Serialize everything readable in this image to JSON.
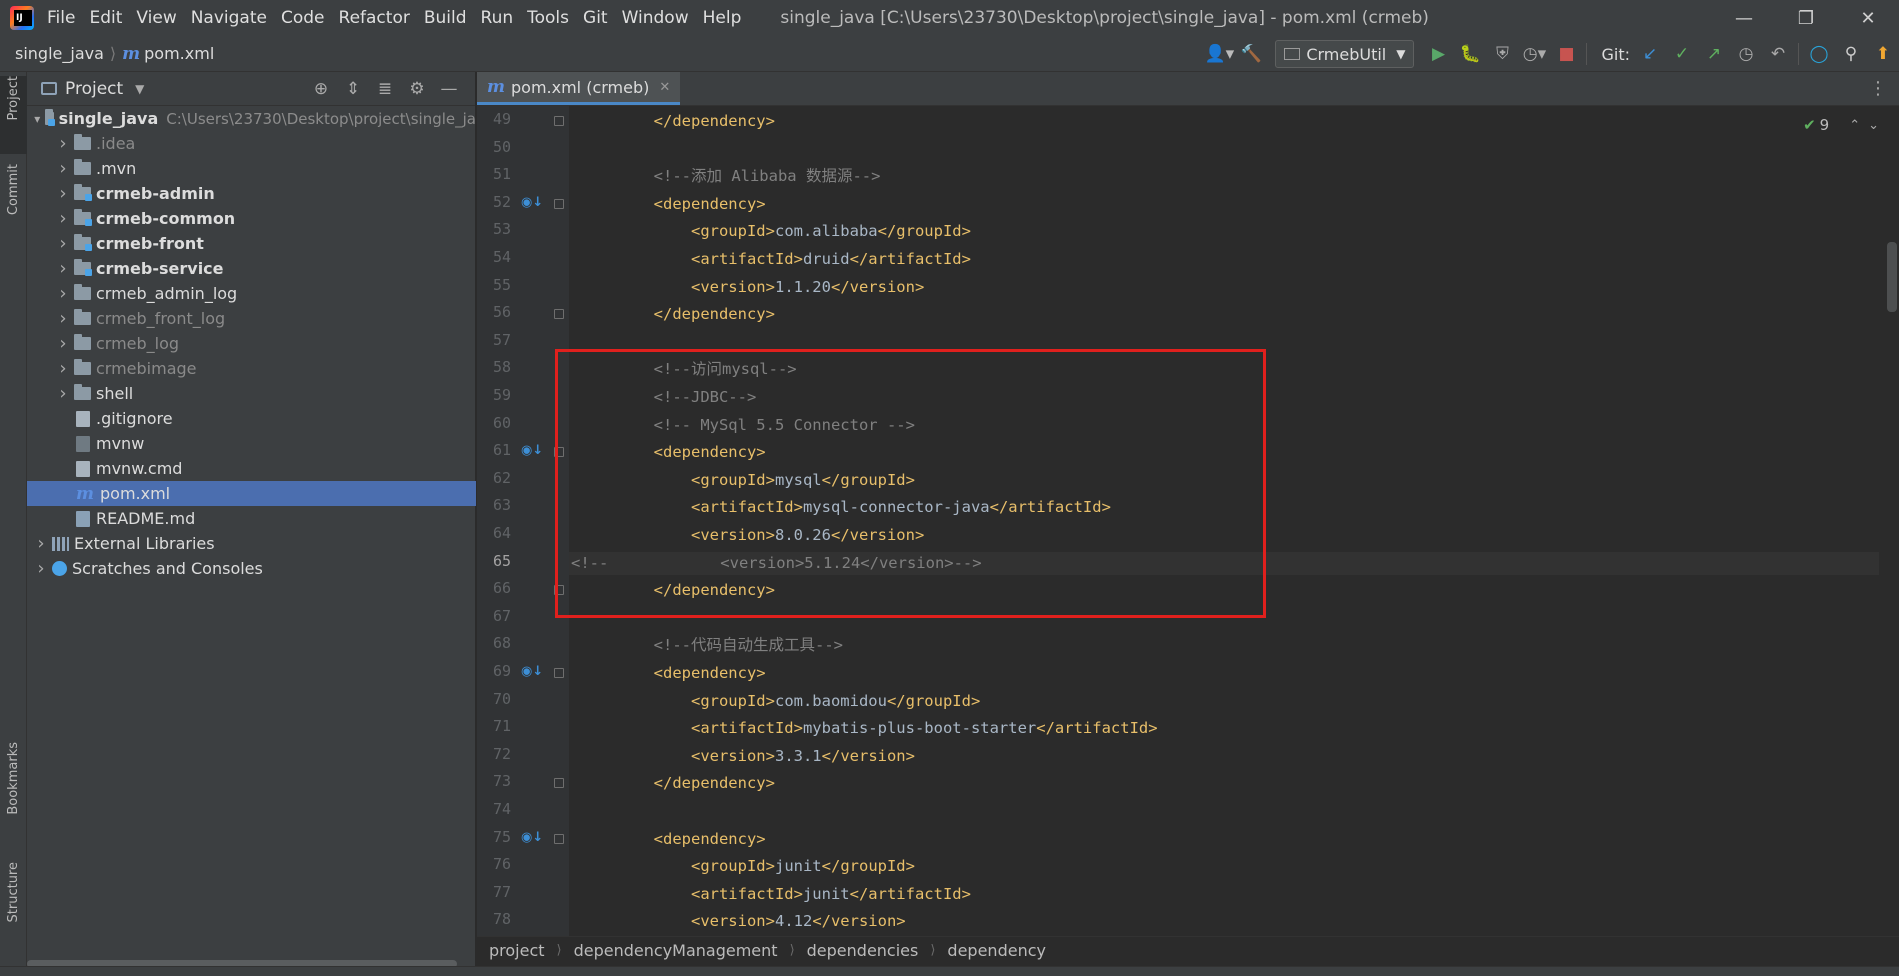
{
  "menubar": {
    "items": [
      "File",
      "Edit",
      "View",
      "Navigate",
      "Code",
      "Refactor",
      "Build",
      "Run",
      "Tools",
      "Git",
      "Window",
      "Help"
    ],
    "window_title": "single_java [C:\\Users\\23730\\Desktop\\project\\single_java] - pom.xml (crmeb)"
  },
  "navbar": {
    "project": "single_java",
    "file": "pom.xml",
    "run_config": "CrmebUtil",
    "git_label": "Git:"
  },
  "left_strip": {
    "tabs": [
      "Project",
      "Commit",
      "Bookmarks",
      "Structure"
    ]
  },
  "project_panel": {
    "title": "Project",
    "tree": [
      {
        "label": "single_java",
        "hint": "C:\\Users\\23730\\Desktop\\project\\single_ja",
        "depth": 0,
        "kind": "module",
        "expand": "open",
        "bold": true
      },
      {
        "label": ".idea",
        "depth": 1,
        "kind": "folder",
        "expand": "closed",
        "dim": true
      },
      {
        "label": ".mvn",
        "depth": 1,
        "kind": "folder",
        "expand": "closed"
      },
      {
        "label": "crmeb-admin",
        "depth": 1,
        "kind": "module",
        "expand": "closed",
        "bold": true
      },
      {
        "label": "crmeb-common",
        "depth": 1,
        "kind": "module",
        "expand": "closed",
        "bold": true
      },
      {
        "label": "crmeb-front",
        "depth": 1,
        "kind": "module",
        "expand": "closed",
        "bold": true
      },
      {
        "label": "crmeb-service",
        "depth": 1,
        "kind": "module",
        "expand": "closed",
        "bold": true
      },
      {
        "label": "crmeb_admin_log",
        "depth": 1,
        "kind": "folder",
        "expand": "closed"
      },
      {
        "label": "crmeb_front_log",
        "depth": 1,
        "kind": "folder",
        "expand": "closed",
        "dim": true
      },
      {
        "label": "crmeb_log",
        "depth": 1,
        "kind": "folder",
        "expand": "closed",
        "dim": true
      },
      {
        "label": "crmebimage",
        "depth": 1,
        "kind": "folder",
        "expand": "closed",
        "dim": true
      },
      {
        "label": "shell",
        "depth": 1,
        "kind": "folder",
        "expand": "closed"
      },
      {
        "label": ".gitignore",
        "depth": 1,
        "kind": "file"
      },
      {
        "label": "mvnw",
        "depth": 1,
        "kind": "shfile"
      },
      {
        "label": "mvnw.cmd",
        "depth": 1,
        "kind": "file"
      },
      {
        "label": "pom.xml",
        "depth": 1,
        "kind": "maven",
        "selected": true
      },
      {
        "label": "README.md",
        "depth": 1,
        "kind": "mdfile"
      },
      {
        "label": "External Libraries",
        "depth": 0,
        "kind": "library",
        "expand": "closed"
      },
      {
        "label": "Scratches and Consoles",
        "depth": 0,
        "kind": "scratch",
        "expand": "closed"
      }
    ]
  },
  "editor": {
    "tab_label": "pom.xml (crmeb)",
    "inspection_count": "9",
    "current_line": 65,
    "lines": [
      {
        "n": 49,
        "parts": [
          {
            "t": "        ",
            "c": "txt"
          },
          {
            "t": "</dependency>",
            "c": "tag"
          }
        ]
      },
      {
        "n": 50,
        "parts": []
      },
      {
        "n": 51,
        "parts": [
          {
            "t": "        ",
            "c": "txt"
          },
          {
            "t": "<!--添加 Alibaba 数据源-->",
            "c": "cmt"
          }
        ]
      },
      {
        "n": 52,
        "parts": [
          {
            "t": "        ",
            "c": "txt"
          },
          {
            "t": "<dependency>",
            "c": "tag"
          }
        ],
        "mark": true
      },
      {
        "n": 53,
        "parts": [
          {
            "t": "            ",
            "c": "txt"
          },
          {
            "t": "<groupId>",
            "c": "tag"
          },
          {
            "t": "com.alibaba",
            "c": "txt"
          },
          {
            "t": "</groupId>",
            "c": "tag"
          }
        ]
      },
      {
        "n": 54,
        "parts": [
          {
            "t": "            ",
            "c": "txt"
          },
          {
            "t": "<artifactId>",
            "c": "tag"
          },
          {
            "t": "druid",
            "c": "txt"
          },
          {
            "t": "</artifactId>",
            "c": "tag"
          }
        ]
      },
      {
        "n": 55,
        "parts": [
          {
            "t": "            ",
            "c": "txt"
          },
          {
            "t": "<version>",
            "c": "tag"
          },
          {
            "t": "1.1.20",
            "c": "txt"
          },
          {
            "t": "</version>",
            "c": "tag"
          }
        ]
      },
      {
        "n": 56,
        "parts": [
          {
            "t": "        ",
            "c": "txt"
          },
          {
            "t": "</dependency>",
            "c": "tag"
          }
        ]
      },
      {
        "n": 57,
        "parts": []
      },
      {
        "n": 58,
        "parts": [
          {
            "t": "        ",
            "c": "txt"
          },
          {
            "t": "<!--访问mysql-->",
            "c": "cmt"
          }
        ]
      },
      {
        "n": 59,
        "parts": [
          {
            "t": "        ",
            "c": "txt"
          },
          {
            "t": "<!--JDBC-->",
            "c": "cmt"
          }
        ]
      },
      {
        "n": 60,
        "parts": [
          {
            "t": "        ",
            "c": "txt"
          },
          {
            "t": "<!-- MySql 5.5 Connector -->",
            "c": "cmt"
          }
        ]
      },
      {
        "n": 61,
        "parts": [
          {
            "t": "        ",
            "c": "txt"
          },
          {
            "t": "<dependency>",
            "c": "tag"
          }
        ],
        "mark": true
      },
      {
        "n": 62,
        "parts": [
          {
            "t": "            ",
            "c": "txt"
          },
          {
            "t": "<groupId>",
            "c": "tag"
          },
          {
            "t": "mysql",
            "c": "txt"
          },
          {
            "t": "</groupId>",
            "c": "tag"
          }
        ]
      },
      {
        "n": 63,
        "parts": [
          {
            "t": "            ",
            "c": "txt"
          },
          {
            "t": "<artifactId>",
            "c": "tag"
          },
          {
            "t": "mysql-connector-java",
            "c": "txt"
          },
          {
            "t": "</artifactId>",
            "c": "tag"
          }
        ]
      },
      {
        "n": 64,
        "parts": [
          {
            "t": "            ",
            "c": "txt"
          },
          {
            "t": "<version>",
            "c": "tag"
          },
          {
            "t": "8.0.26",
            "c": "txt"
          },
          {
            "t": "</version>",
            "c": "tag"
          }
        ]
      },
      {
        "n": 65,
        "parts": [
          {
            "t": "<!--            <version>5.1.24</version>-->",
            "c": "cmt"
          }
        ]
      },
      {
        "n": 66,
        "parts": [
          {
            "t": "        ",
            "c": "txt"
          },
          {
            "t": "</dependency>",
            "c": "tag"
          }
        ]
      },
      {
        "n": 67,
        "parts": []
      },
      {
        "n": 68,
        "parts": [
          {
            "t": "        ",
            "c": "txt"
          },
          {
            "t": "<!--代码自动生成工具-->",
            "c": "cmt"
          }
        ]
      },
      {
        "n": 69,
        "parts": [
          {
            "t": "        ",
            "c": "txt"
          },
          {
            "t": "<dependency>",
            "c": "tag"
          }
        ],
        "mark": true
      },
      {
        "n": 70,
        "parts": [
          {
            "t": "            ",
            "c": "txt"
          },
          {
            "t": "<groupId>",
            "c": "tag"
          },
          {
            "t": "com.baomidou",
            "c": "txt"
          },
          {
            "t": "</groupId>",
            "c": "tag"
          }
        ]
      },
      {
        "n": 71,
        "parts": [
          {
            "t": "            ",
            "c": "txt"
          },
          {
            "t": "<artifactId>",
            "c": "tag"
          },
          {
            "t": "mybatis-plus-boot-starter",
            "c": "txt"
          },
          {
            "t": "</artifactId>",
            "c": "tag"
          }
        ]
      },
      {
        "n": 72,
        "parts": [
          {
            "t": "            ",
            "c": "txt"
          },
          {
            "t": "<version>",
            "c": "tag"
          },
          {
            "t": "3.3.1",
            "c": "txt"
          },
          {
            "t": "</version>",
            "c": "tag"
          }
        ]
      },
      {
        "n": 73,
        "parts": [
          {
            "t": "        ",
            "c": "txt"
          },
          {
            "t": "</dependency>",
            "c": "tag"
          }
        ]
      },
      {
        "n": 74,
        "parts": []
      },
      {
        "n": 75,
        "parts": [
          {
            "t": "        ",
            "c": "txt"
          },
          {
            "t": "<dependency>",
            "c": "tag"
          }
        ],
        "mark": true
      },
      {
        "n": 76,
        "parts": [
          {
            "t": "            ",
            "c": "txt"
          },
          {
            "t": "<groupId>",
            "c": "tag"
          },
          {
            "t": "junit",
            "c": "txt"
          },
          {
            "t": "</groupId>",
            "c": "tag"
          }
        ]
      },
      {
        "n": 77,
        "parts": [
          {
            "t": "            ",
            "c": "txt"
          },
          {
            "t": "<artifactId>",
            "c": "tag"
          },
          {
            "t": "junit",
            "c": "txt"
          },
          {
            "t": "</artifactId>",
            "c": "tag"
          }
        ]
      },
      {
        "n": 78,
        "parts": [
          {
            "t": "            ",
            "c": "txt"
          },
          {
            "t": "<version>",
            "c": "tag"
          },
          {
            "t": "4.12",
            "c": "txt"
          },
          {
            "t": "</version>",
            "c": "tag"
          }
        ]
      }
    ],
    "breadcrumbs": [
      "project",
      "dependencyManagement",
      "dependencies",
      "dependency"
    ]
  },
  "colors": {
    "tag": "#e8bf6a",
    "text": "#a9b7c6",
    "comment": "#808080",
    "selection": "#4b6eaf",
    "highlight_box": "#e0201d"
  }
}
